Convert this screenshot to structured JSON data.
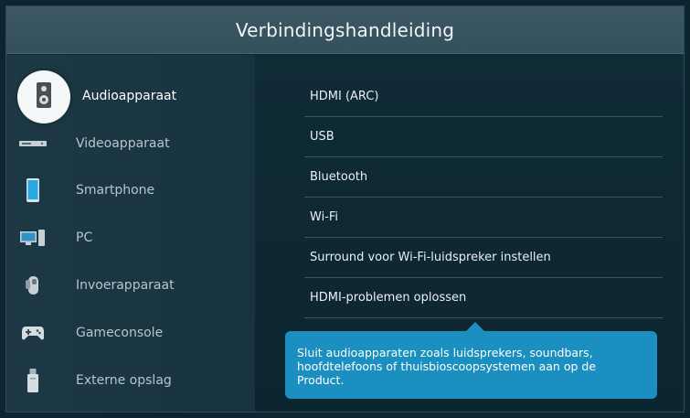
{
  "header": {
    "title": "Verbindingshandleiding"
  },
  "sidebar": {
    "items": [
      {
        "label": "Audioapparaat",
        "icon": "speaker-icon",
        "selected": true
      },
      {
        "label": "Videoapparaat",
        "icon": "video-player-icon",
        "selected": false
      },
      {
        "label": "Smartphone",
        "icon": "smartphone-icon",
        "selected": false
      },
      {
        "label": "PC",
        "icon": "pc-icon",
        "selected": false
      },
      {
        "label": "Invoerapparaat",
        "icon": "input-device-icon",
        "selected": false
      },
      {
        "label": "Gameconsole",
        "icon": "gamepad-icon",
        "selected": false
      },
      {
        "label": "Externe opslag",
        "icon": "usb-drive-icon",
        "selected": false
      }
    ]
  },
  "menu": {
    "items": [
      {
        "label": "HDMI (ARC)"
      },
      {
        "label": "USB"
      },
      {
        "label": "Bluetooth"
      },
      {
        "label": "Wi-Fi"
      },
      {
        "label": "Surround voor Wi-Fi-luidspreker instellen"
      },
      {
        "label": "HDMI-problemen oplossen"
      }
    ]
  },
  "tooltip": {
    "text": "Sluit audioapparaten zoals luidsprekers, soundbars, hoofdtelefoons of thuisbioscoopsystemen aan op de Product."
  },
  "colors": {
    "background": "#0f2a35",
    "header": "#3a5662",
    "sidebar": "#1b3743",
    "accent": "#1b8fc0",
    "selected_bubble": "#f4f6f7"
  }
}
